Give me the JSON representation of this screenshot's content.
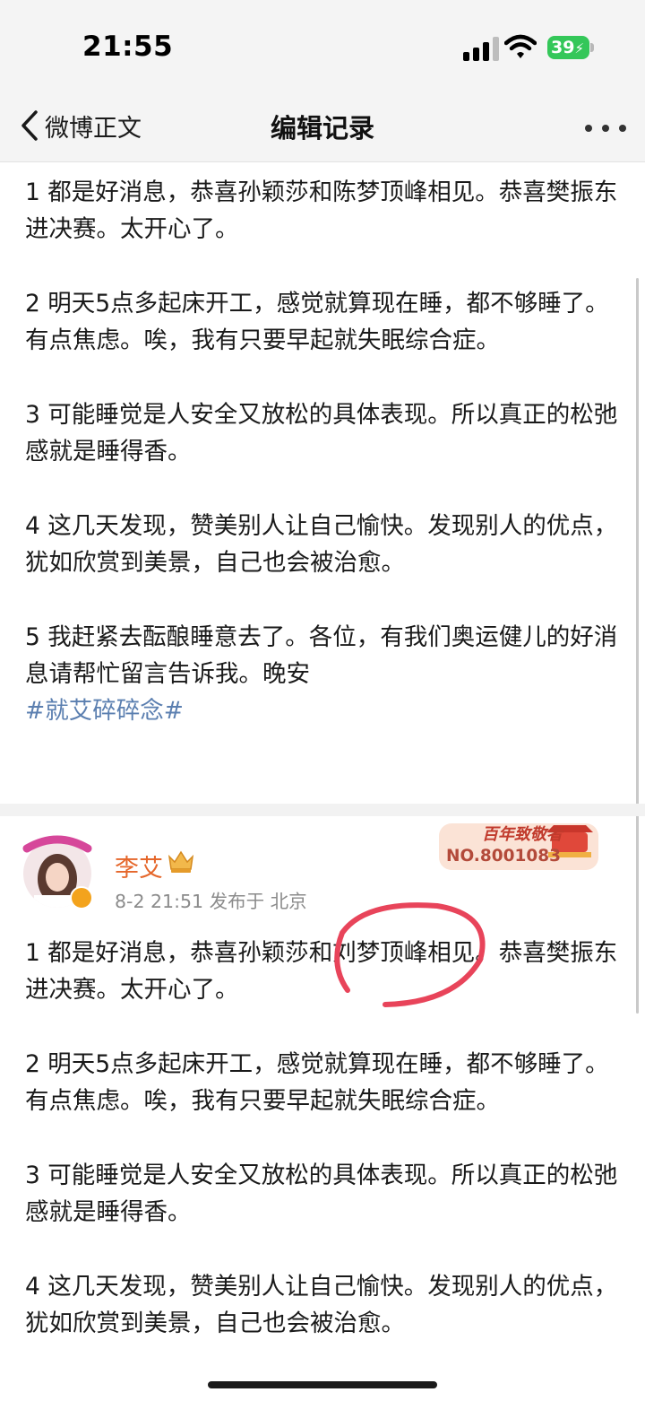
{
  "status": {
    "time": "21:55",
    "battery": "39"
  },
  "nav": {
    "back_label": "微博正文",
    "title": "编辑记录"
  },
  "version1": {
    "paragraphs": [
      "1 都是好消息，恭喜孙颖莎和陈梦顶峰相见。恭喜樊振东进决赛。太开心了。",
      "2 明天5点多起床开工，感觉就算现在睡，都不够睡了。有点焦虑。唉，我有只要早起就失眠综合症。",
      "3 可能睡觉是人安全又放松的具体表现。所以真正的松弛感就是睡得香。",
      "4  这几天发现，赞美别人让自己愉快。发现别人的优点，犹如欣赏到美景，自己也会被治愈。",
      "5 我赶紧去酝酿睡意去了。各位，有我们奥运健儿的好消息请帮忙留言告诉我。晚安"
    ],
    "hashtag": "#就艾碎碎念#"
  },
  "author": {
    "name": "李艾",
    "meta": "8-2 21:51  发布于 北京",
    "medal_top": "百年致敬者",
    "medal_no": "NO.8001083"
  },
  "version2": {
    "paragraphs": [
      "1 都是好消息，恭喜孙颖莎和刘梦顶峰相见。恭喜樊振东进决赛。太开心了。",
      "2 明天5点多起床开工，感觉就算现在睡，都不够睡了。有点焦虑。唉，我有只要早起就失眠综合症。",
      "3 可能睡觉是人安全又放松的具体表现。所以真正的松弛感就是睡得香。",
      "4  这几天发现，赞美别人让自己愉快。发现别人的优点，犹如欣赏到美景，自己也会被治愈。"
    ]
  },
  "colors": {
    "author": "#e5662a",
    "hashtag": "#5b7fb0",
    "circle": "#e8445a"
  }
}
